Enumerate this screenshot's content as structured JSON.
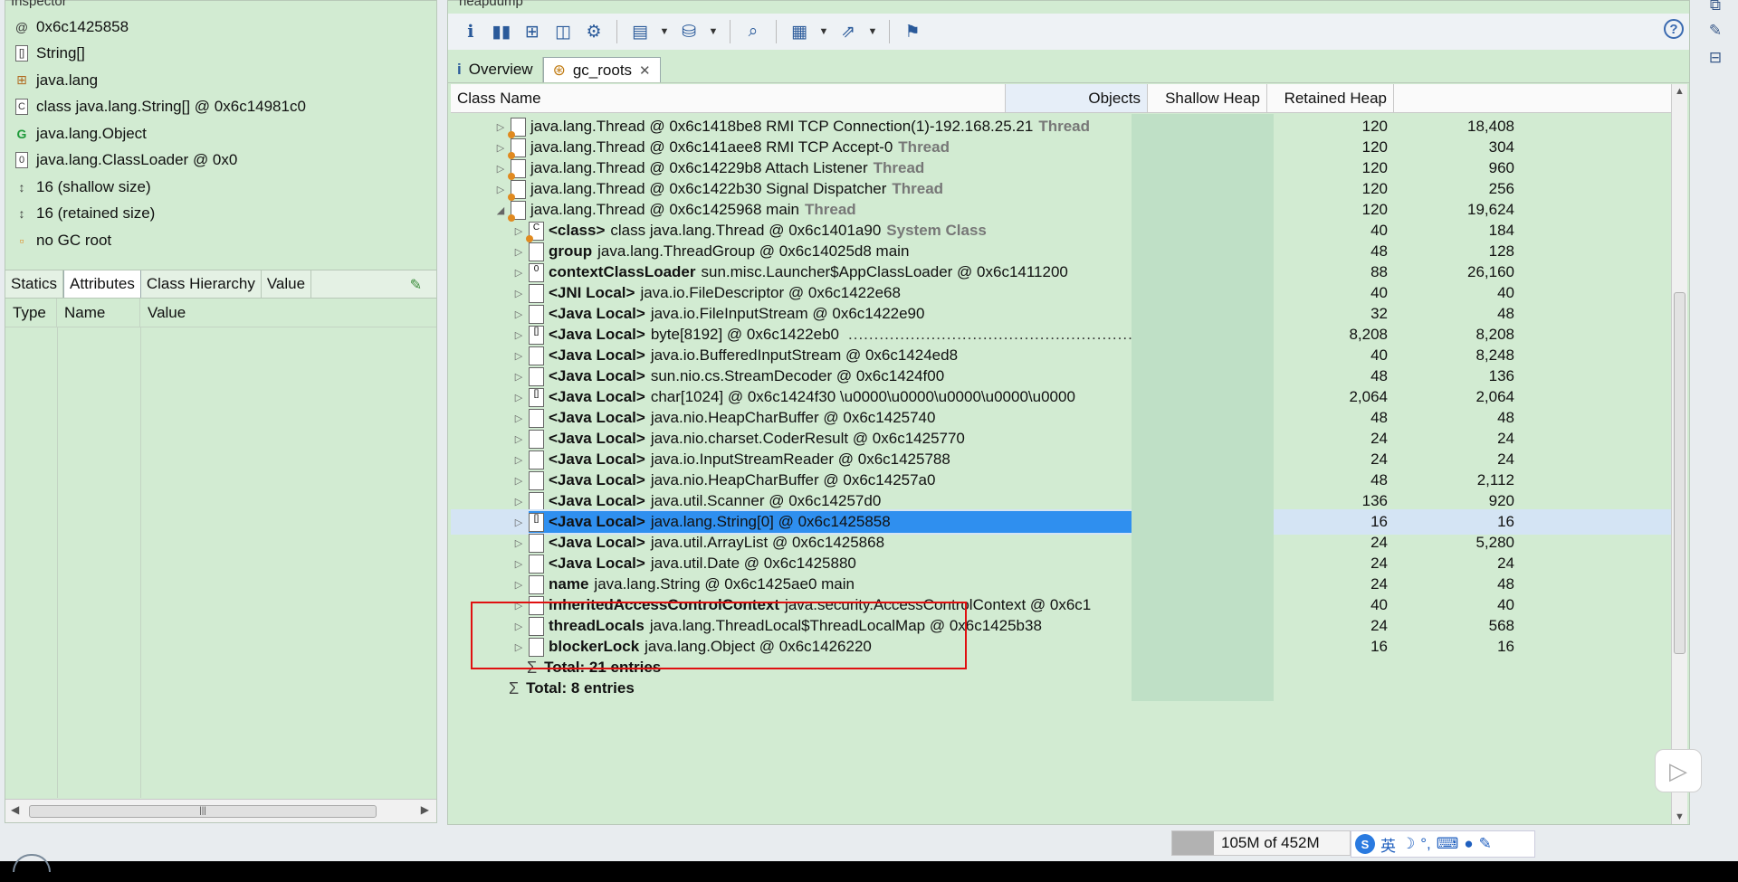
{
  "inspector": {
    "title": "Inspector",
    "items": [
      {
        "icon": "at-icon",
        "glyph": "@",
        "text": "0x6c1425858"
      },
      {
        "icon": "array-icon",
        "glyph": "[]",
        "text": "String[]"
      },
      {
        "icon": "package-icon",
        "glyph": "⊞",
        "text": "java.lang"
      },
      {
        "icon": "class-icon",
        "glyph": "C",
        "text": "class java.lang.String[] @ 0x6c14981c0"
      },
      {
        "icon": "superclass-icon",
        "glyph": "G",
        "text": "java.lang.Object"
      },
      {
        "icon": "classloader-icon",
        "glyph": "0",
        "text": "java.lang.ClassLoader @ 0x0"
      },
      {
        "icon": "size-icon",
        "glyph": "↕",
        "text": "16 (shallow size)"
      },
      {
        "icon": "size-icon",
        "glyph": "↕",
        "text": "16 (retained size)"
      },
      {
        "icon": "gc-root-icon",
        "glyph": "▫",
        "text": "no GC root"
      }
    ],
    "tabs": [
      "Statics",
      "Attributes",
      "Class Hierarchy",
      "Value"
    ],
    "active_tab": "Attributes",
    "columns": [
      "Type",
      "Name",
      "Value"
    ]
  },
  "editor": {
    "title": "heapdump",
    "tabs": [
      {
        "label": "Overview",
        "icon": "info-icon"
      },
      {
        "label": "gc_roots",
        "icon": "gc-roots-icon",
        "closable": true
      }
    ],
    "columns": {
      "class_name": "Class Name",
      "objects": "Objects",
      "shallow": "Shallow Heap",
      "retained": "Retained Heap"
    },
    "rows": [
      {
        "depth": 0,
        "twisty": "▷",
        "icon": "thread",
        "ref": "",
        "name": "java.lang.Thread @ 0x6c1418be8  RMI TCP Connection(1)-192.168.25.21",
        "tag": "Thread",
        "shallow": "120",
        "retained": "18,408"
      },
      {
        "depth": 0,
        "twisty": "▷",
        "icon": "thread",
        "ref": "",
        "name": "java.lang.Thread @ 0x6c141aee8  RMI TCP Accept-0",
        "tag": "Thread",
        "shallow": "120",
        "retained": "304"
      },
      {
        "depth": 0,
        "twisty": "▷",
        "icon": "thread",
        "ref": "",
        "name": "java.lang.Thread @ 0x6c14229b8  Attach Listener",
        "tag": "Thread",
        "shallow": "120",
        "retained": "960"
      },
      {
        "depth": 0,
        "twisty": "▷",
        "icon": "thread",
        "ref": "",
        "name": "java.lang.Thread @ 0x6c1422b30  Signal Dispatcher",
        "tag": "Thread",
        "shallow": "120",
        "retained": "256"
      },
      {
        "depth": 0,
        "twisty": "◢",
        "icon": "thread",
        "ref": "",
        "name": "java.lang.Thread @ 0x6c1425968  main",
        "tag": "Thread",
        "shallow": "120",
        "retained": "19,624"
      },
      {
        "depth": 1,
        "twisty": "▷",
        "icon": "class",
        "ref": "<class>",
        "name": "class java.lang.Thread @ 0x6c1401a90",
        "tag": "System Class",
        "shallow": "40",
        "retained": "184"
      },
      {
        "depth": 1,
        "twisty": "▷",
        "icon": "obj",
        "ref": "group",
        "name": "java.lang.ThreadGroup @ 0x6c14025d8  main",
        "tag": "",
        "shallow": "48",
        "retained": "128"
      },
      {
        "depth": 1,
        "twisty": "▷",
        "icon": "loader",
        "ref": "contextClassLoader",
        "name": "sun.misc.Launcher$AppClassLoader @ 0x6c1411200",
        "tag": "",
        "shallow": "88",
        "retained": "26,160"
      },
      {
        "depth": 1,
        "twisty": "▷",
        "icon": "obj",
        "ref": "<JNI Local>",
        "name": "java.io.FileDescriptor @ 0x6c1422e68",
        "tag": "",
        "shallow": "40",
        "retained": "40"
      },
      {
        "depth": 1,
        "twisty": "▷",
        "icon": "obj",
        "ref": "<Java Local>",
        "name": "java.io.FileInputStream @ 0x6c1422e90",
        "tag": "",
        "shallow": "32",
        "retained": "48"
      },
      {
        "depth": 1,
        "twisty": "▷",
        "icon": "array",
        "ref": "<Java Local>",
        "name": "byte[8192] @ 0x6c1422eb0",
        "tag": "",
        "dots": "...............................................................",
        "shallow": "8,208",
        "retained": "8,208"
      },
      {
        "depth": 1,
        "twisty": "▷",
        "icon": "obj",
        "ref": "<Java Local>",
        "name": "java.io.BufferedInputStream @ 0x6c1424ed8",
        "tag": "",
        "shallow": "40",
        "retained": "8,248"
      },
      {
        "depth": 1,
        "twisty": "▷",
        "icon": "obj",
        "ref": "<Java Local>",
        "name": "sun.nio.cs.StreamDecoder @ 0x6c1424f00",
        "tag": "",
        "shallow": "48",
        "retained": "136"
      },
      {
        "depth": 1,
        "twisty": "▷",
        "icon": "array",
        "ref": "<Java Local>",
        "name": "char[1024] @ 0x6c1424f30  \\u0000\\u0000\\u0000\\u0000\\u0000",
        "tag": "",
        "shallow": "2,064",
        "retained": "2,064"
      },
      {
        "depth": 1,
        "twisty": "▷",
        "icon": "obj",
        "ref": "<Java Local>",
        "name": "java.nio.HeapCharBuffer @ 0x6c1425740",
        "tag": "",
        "shallow": "48",
        "retained": "48"
      },
      {
        "depth": 1,
        "twisty": "▷",
        "icon": "obj",
        "ref": "<Java Local>",
        "name": "java.nio.charset.CoderResult @ 0x6c1425770",
        "tag": "",
        "shallow": "24",
        "retained": "24"
      },
      {
        "depth": 1,
        "twisty": "▷",
        "icon": "obj",
        "ref": "<Java Local>",
        "name": "java.io.InputStreamReader @ 0x6c1425788",
        "tag": "",
        "shallow": "24",
        "retained": "24"
      },
      {
        "depth": 1,
        "twisty": "▷",
        "icon": "obj",
        "ref": "<Java Local>",
        "name": "java.nio.HeapCharBuffer @ 0x6c14257a0",
        "tag": "",
        "shallow": "48",
        "retained": "2,112"
      },
      {
        "depth": 1,
        "twisty": "▷",
        "icon": "obj",
        "ref": "<Java Local>",
        "name": "java.util.Scanner @ 0x6c14257d0",
        "tag": "",
        "shallow": "136",
        "retained": "920"
      },
      {
        "depth": 1,
        "twisty": "▷",
        "icon": "array",
        "ref": "<Java Local>",
        "name": "java.lang.String[0] @ 0x6c1425858",
        "tag": "",
        "shallow": "16",
        "retained": "16",
        "selected": true
      },
      {
        "depth": 1,
        "twisty": "▷",
        "icon": "obj",
        "ref": "<Java Local>",
        "name": "java.util.ArrayList @ 0x6c1425868",
        "tag": "",
        "shallow": "24",
        "retained": "5,280"
      },
      {
        "depth": 1,
        "twisty": "▷",
        "icon": "obj",
        "ref": "<Java Local>",
        "name": "java.util.Date @ 0x6c1425880",
        "tag": "",
        "shallow": "24",
        "retained": "24"
      },
      {
        "depth": 1,
        "twisty": "▷",
        "icon": "obj",
        "ref": "name",
        "name": "java.lang.String @ 0x6c1425ae0  main",
        "tag": "",
        "shallow": "24",
        "retained": "48"
      },
      {
        "depth": 1,
        "twisty": "▷",
        "icon": "obj",
        "ref": "inheritedAccessControlContext",
        "name": "java.security.AccessControlContext @ 0x6c1",
        "tag": "",
        "shallow": "40",
        "retained": "40"
      },
      {
        "depth": 1,
        "twisty": "▷",
        "icon": "obj",
        "ref": "threadLocals",
        "name": "java.lang.ThreadLocal$ThreadLocalMap @ 0x6c1425b38",
        "tag": "",
        "shallow": "24",
        "retained": "568"
      },
      {
        "depth": 1,
        "twisty": "▷",
        "icon": "obj",
        "ref": "blockerLock",
        "name": "java.lang.Object @ 0x6c1426220",
        "tag": "",
        "shallow": "16",
        "retained": "16"
      }
    ],
    "totals": [
      {
        "depth": 1,
        "label": "Total: 21 entries"
      },
      {
        "depth": 0,
        "label": "Total: 8 entries"
      }
    ]
  },
  "status": {
    "heap": "105M of 452M",
    "heap_used_fraction": 0.23,
    "ime_lang": "英"
  },
  "colors": {
    "panel_bg": "#d2ebd2",
    "selection": "#2f8fef",
    "highlight_box": "#e01010"
  }
}
